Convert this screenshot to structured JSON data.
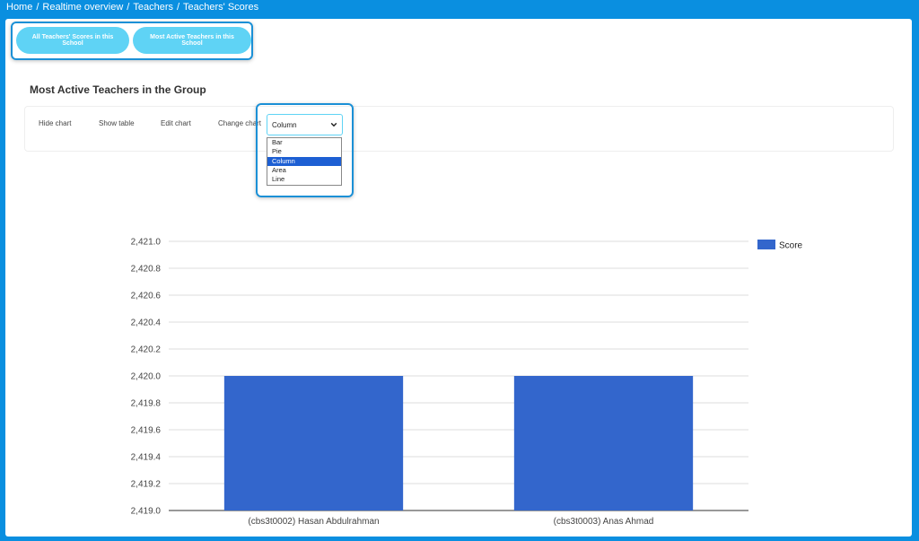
{
  "breadcrumb": {
    "home": "Home",
    "realtime": "Realtime overview",
    "teachers": "Teachers",
    "current": "Teachers' Scores",
    "separator": "/"
  },
  "tabs": {
    "all_scores": "All Teachers' Scores in this School",
    "most_active": "Most Active Teachers in this School"
  },
  "section": {
    "title": "Most Active Teachers in the Group"
  },
  "toolbar": {
    "hide_chart": "Hide chart",
    "show_table": "Show table",
    "edit_chart": "Edit chart",
    "change_chart": "Change chart",
    "selected": "Column",
    "options": [
      "Bar",
      "Pie",
      "Column",
      "Area",
      "Line"
    ]
  },
  "colors": {
    "bar": "#3366cc",
    "accent": "#5fd3f5",
    "focus": "#1b90d6"
  },
  "chart_data": {
    "type": "bar",
    "categories": [
      "(cbs3t0002) Hasan Abdulrahman",
      "(cbs3t0003) Anas Ahmad"
    ],
    "series": [
      {
        "name": "Score",
        "values": [
          2420,
          2420
        ]
      }
    ],
    "ylim": [
      2419,
      2421
    ],
    "yticks": [
      "2,419.0",
      "2,419.2",
      "2,419.4",
      "2,419.6",
      "2,419.8",
      "2,420.0",
      "2,420.2",
      "2,420.4",
      "2,420.6",
      "2,420.8",
      "2,421.0"
    ],
    "ytick_values": [
      2419.0,
      2419.2,
      2419.4,
      2419.6,
      2419.8,
      2420.0,
      2420.2,
      2420.4,
      2420.6,
      2420.8,
      2421.0
    ],
    "grid": true,
    "legend": "top-right"
  }
}
